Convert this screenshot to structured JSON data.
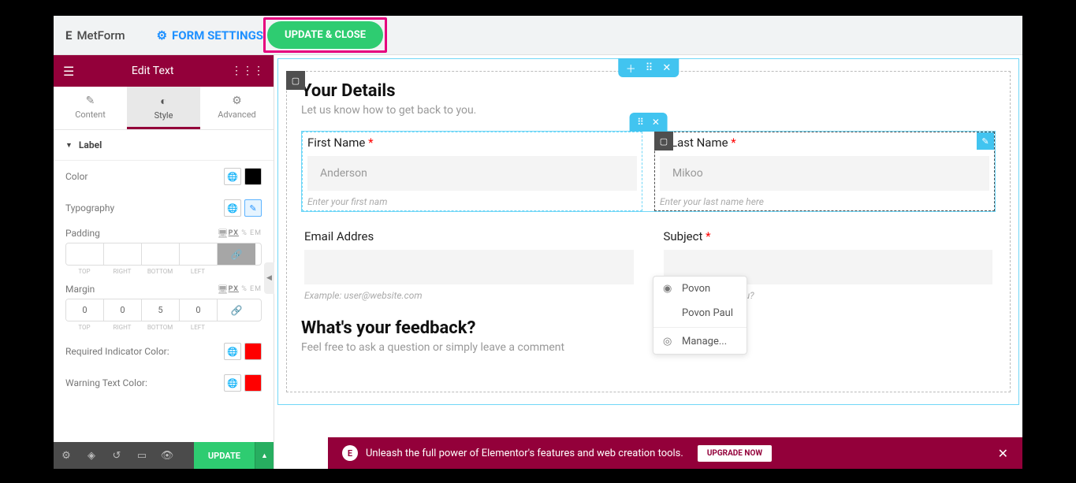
{
  "topbar": {
    "brand": "MetForm",
    "form_settings": "FORM SETTINGS",
    "update_close": "UPDATE & CLOSE"
  },
  "sidebar": {
    "header_title": "Edit Text",
    "tabs": {
      "content": "Content",
      "style": "Style",
      "advanced": "Advanced"
    },
    "section_label": "Label",
    "color_lbl": "Color",
    "typo_lbl": "Typography",
    "padding_lbl": "Padding",
    "margin_lbl": "Margin",
    "units": {
      "px": "PX",
      "pct": "%",
      "em": "EM"
    },
    "dirs": {
      "top": "TOP",
      "right": "RIGHT",
      "bottom": "BOTTOM",
      "left": "LEFT"
    },
    "padding_vals": [
      "",
      "",
      "",
      ""
    ],
    "margin_vals": [
      "0",
      "0",
      "5",
      "0"
    ],
    "req_ind_lbl": "Required Indicator Color:",
    "warn_lbl": "Warning Text Color:",
    "colors": {
      "label_swatch": "#000000",
      "req_swatch": "#ff0000",
      "warn_swatch": "#ff0000"
    }
  },
  "footer": {
    "update": "UPDATE"
  },
  "canvas": {
    "h1": "Your Details",
    "sub1": "Let us know how to get back to you.",
    "fn_label": "First Name ",
    "fn_val": "Anderson",
    "fn_help": "Enter your first nam",
    "ln_label": "Last Name ",
    "ln_val": "Mikoo",
    "ln_help": "Enter your last name here",
    "email_label": "Email Addres",
    "email_help": "Example: user@website.com",
    "subj_label": "Subject ",
    "subj_help": "How can we help you?",
    "h2": "What's your feedback?",
    "sub2": "Feel free to ask a question or simply leave a comment"
  },
  "autocomplete": {
    "opt1": "Povon",
    "opt2": "Povon Paul",
    "manage": "Manage..."
  },
  "promo": {
    "text": "Unleash the full power of Elementor's features and web creation tools.",
    "upgrade": "UPGRADE NOW"
  }
}
